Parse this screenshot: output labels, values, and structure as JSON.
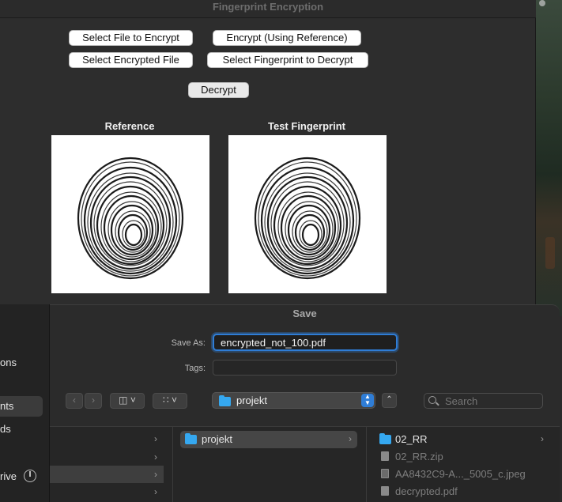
{
  "app": {
    "title": "Fingerprint Encryption",
    "buttons": {
      "select_file": "Select File to Encrypt",
      "encrypt": "Encrypt (Using Reference)",
      "select_encrypted": "Select Encrypted File",
      "select_fingerprint": "Select Fingerprint to Decrypt",
      "decrypt": "Decrypt"
    },
    "images": {
      "reference_label": "Reference",
      "test_label": "Test Fingerprint"
    }
  },
  "save_dialog": {
    "title": "Save",
    "save_as_label": "Save As:",
    "save_as_value": "encrypted_not_100.pdf",
    "tags_label": "Tags:",
    "location": "projekt",
    "search_placeholder": "Search",
    "sidebar": {
      "items": [
        "ons",
        "nts",
        "ds",
        "rive"
      ]
    },
    "columns": {
      "col2": [
        "projekt"
      ],
      "col3": [
        "02_RR",
        "02_RR.zip",
        "AA8432C9-A..._5005_c.jpeg",
        "decrypted.pdf"
      ]
    },
    "icons": {
      "back": "chevron-left-icon",
      "forward": "chevron-right-icon",
      "view": "columns-view-icon",
      "group": "grid-icon",
      "search": "search-icon",
      "eject": "eject-icon"
    },
    "accent_color": "#2f7dd6",
    "folder_color": "#35a8f0"
  }
}
